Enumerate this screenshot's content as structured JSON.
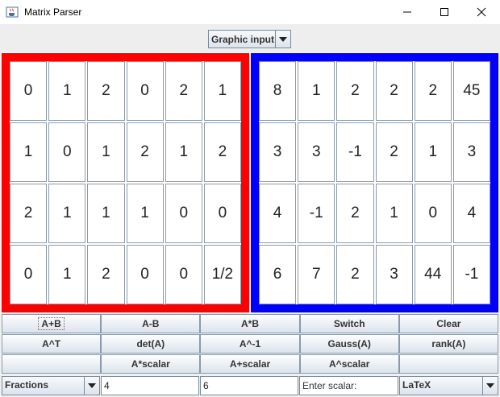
{
  "window": {
    "title": "Matrix Parser",
    "icons": [
      "java-app-icon",
      "minimize-icon",
      "maximize-icon",
      "close-icon"
    ]
  },
  "input_mode": {
    "selected": "Graphic input"
  },
  "colors": {
    "matrix_a_border": "#ff0000",
    "matrix_b_border": "#0000ff"
  },
  "matrix_a": [
    [
      "0",
      "1",
      "2",
      "0",
      "2",
      "1"
    ],
    [
      "1",
      "0",
      "1",
      "2",
      "1",
      "2"
    ],
    [
      "2",
      "1",
      "1",
      "1",
      "0",
      "0"
    ],
    [
      "0",
      "1",
      "2",
      "0",
      "0",
      "1/2"
    ]
  ],
  "matrix_b": [
    [
      "8",
      "1",
      "2",
      "2",
      "2",
      "45"
    ],
    [
      "3",
      "3",
      "-1",
      "2",
      "1",
      "3"
    ],
    [
      "4",
      "-1",
      "2",
      "1",
      "0",
      "4"
    ],
    [
      "6",
      "7",
      "2",
      "3",
      "44",
      "-1"
    ]
  ],
  "buttons": {
    "row1": [
      "A+B",
      "A-B",
      "A*B",
      "Switch",
      "Clear"
    ],
    "row2": [
      "A^T",
      "det(A)",
      "A^-1",
      "Gauss(A)",
      "rank(A)"
    ],
    "row3": [
      "",
      "A*scalar",
      "A+scalar",
      "A^scalar",
      ""
    ]
  },
  "bottom": {
    "number_format": "Fractions",
    "scalar_a": "4",
    "scalar_b": "6",
    "scalar_placeholder": "Enter scalar:",
    "output_format": "LaTeX"
  }
}
